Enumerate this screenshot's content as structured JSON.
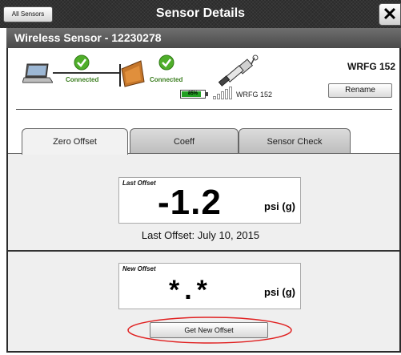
{
  "window": {
    "all_sensors_label": "All Sensors",
    "title": "Sensor Details",
    "close_glyph": "✕"
  },
  "sensor": {
    "header": "Wireless Sensor - 12230278",
    "name": "WRFG 152",
    "rename_label": "Rename",
    "status": {
      "laptop_link": "Connected",
      "sensor_link": "Connected"
    },
    "battery": {
      "text": "85%",
      "level": 0.85,
      "color": "#22a022"
    },
    "signal_label": "WRFG 152"
  },
  "tabs": [
    {
      "label": "Zero Offset",
      "active": true
    },
    {
      "label": "Coeff",
      "active": false
    },
    {
      "label": "Sensor Check",
      "active": false
    }
  ],
  "zero_offset": {
    "last": {
      "caption": "Last Offset",
      "value": "-1.2",
      "unit": "psi (g)"
    },
    "last_date": "Last Offset: July 10, 2015",
    "new": {
      "caption": "New Offset",
      "value": "*.*",
      "unit": "psi (g)"
    },
    "get_button": "Get New Offset"
  },
  "colors": {
    "connected_green": "#3a7d1e",
    "highlight_red": "#e02020"
  }
}
